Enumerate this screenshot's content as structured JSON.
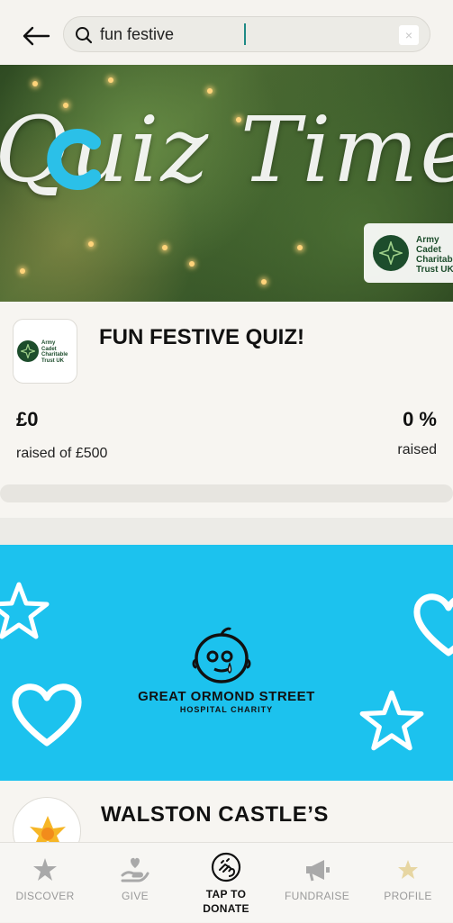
{
  "search": {
    "query": "fun festive",
    "clear_label": "×"
  },
  "card1": {
    "banner_text": "Quiz Time!",
    "badge_lines": [
      "Army",
      "Cadet",
      "Charitable",
      "Trust UK"
    ],
    "org_logo_lines": [
      "Army",
      "Cadet",
      "Charitable",
      "Trust UK"
    ],
    "title": "FUN FESTIVE QUIZ!",
    "raised_amount": "£0",
    "raised_sub": "raised of £500",
    "percent": "0 %",
    "percent_sub": "raised",
    "progress_fraction": 0
  },
  "card2": {
    "banner_line1": "GREAT ORMOND STREET",
    "banner_line2": "HOSPITAL CHARITY",
    "title": "WALSTON CASTLE’S"
  },
  "nav": {
    "discover": "DISCOVER",
    "give": "GIVE",
    "donate_line1": "TAP TO",
    "donate_line2": "DONATE",
    "fundraise": "FUNDRAISE",
    "profile": "PROFILE"
  },
  "colors": {
    "accent": "#1f8a86",
    "go_blue": "#1cc2ee",
    "army_green": "#1d4d2c"
  },
  "icons": [
    "back-arrow-icon",
    "search-icon",
    "close-icon",
    "discover-icon",
    "give-icon",
    "tap-donate-icon",
    "fundraise-icon",
    "profile-star-icon"
  ]
}
